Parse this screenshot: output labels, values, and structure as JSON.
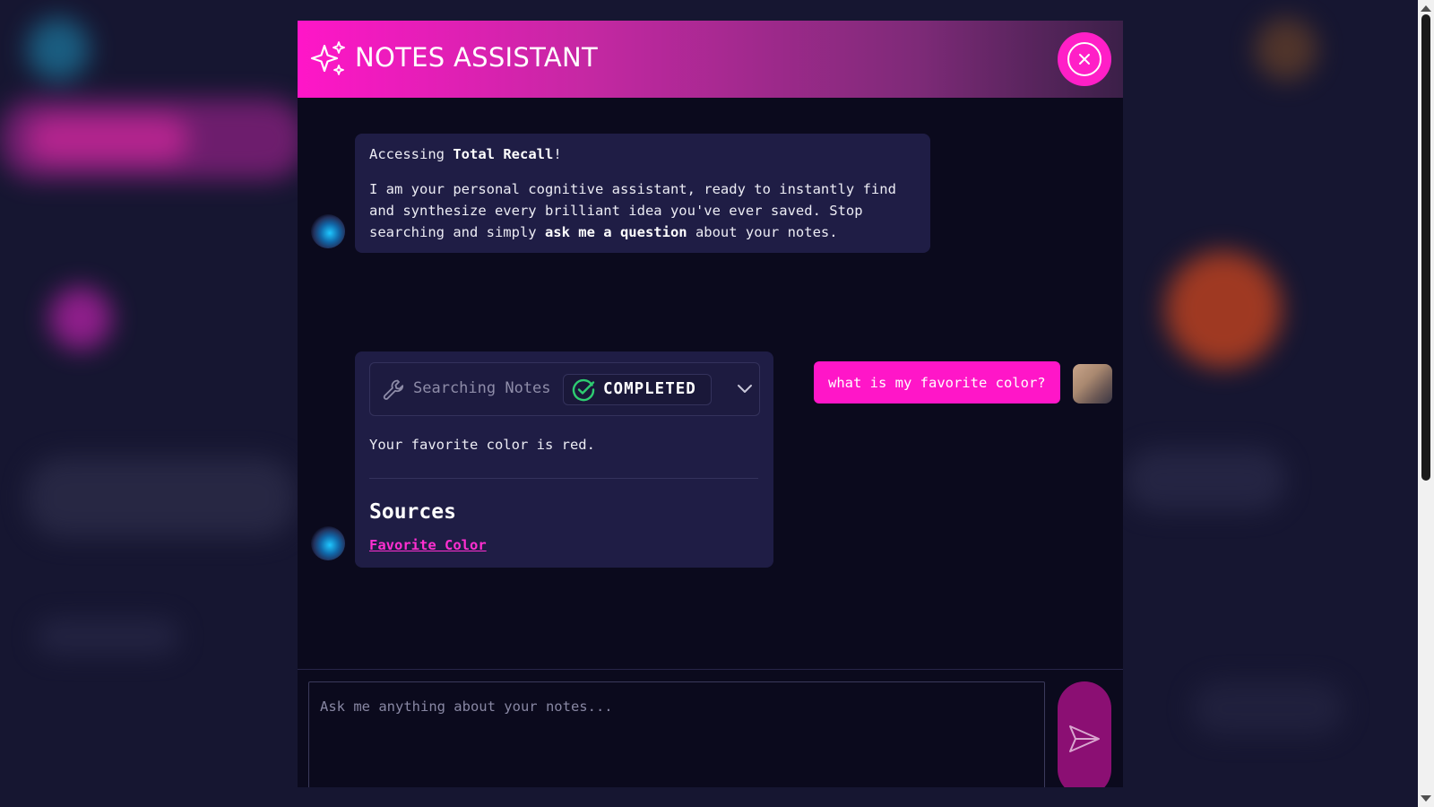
{
  "header": {
    "title": "NOTES ASSISTANT",
    "sparkle_icon": "sparkles-icon",
    "close_icon": "close-circle-icon"
  },
  "messages": {
    "welcome": {
      "intro_prefix": "Accessing ",
      "intro_bold": "Total Recall",
      "intro_suffix": "!",
      "body_prefix": "I am your personal cognitive assistant, ready to instantly find and synthesize every brilliant idea you've ever saved. Stop searching and simply ",
      "body_bold": "ask me a question",
      "body_suffix": " about your notes."
    },
    "user_question": "what is my favorite color?",
    "response": {
      "tool_label": "Searching Notes",
      "tool_status": "COMPLETED",
      "answer": "Your favorite color is red.",
      "sources_title": "Sources",
      "sources": [
        "Favorite Color"
      ]
    }
  },
  "composer": {
    "placeholder": "Ask me anything about your notes...",
    "send_icon": "send-icon"
  },
  "colors": {
    "accent": "#ff16c8",
    "bubble": "#1f1d45",
    "modal_bg": "#0b0a1d",
    "success": "#2ecc71"
  }
}
